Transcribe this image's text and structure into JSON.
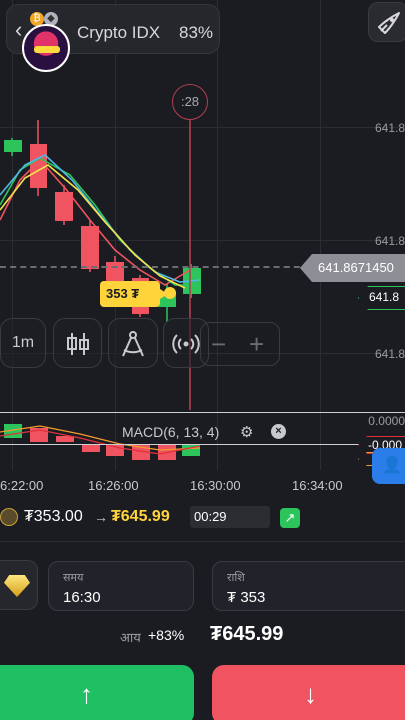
{
  "header": {
    "asset_name": "Crypto IDX",
    "payout_pct": "83%",
    "back_icon": "chevron-left-icon",
    "rocket_icon": "rocket-icon"
  },
  "chart": {
    "timer": ":28",
    "price_levels": [
      "641.8",
      "641.8",
      "641.8"
    ],
    "current_price": "641.8671450",
    "green_tag_price": "641.8",
    "trade_marker": "353 ₮",
    "tools": [
      "1m"
    ],
    "colors": {
      "up": "#2ec45c",
      "down": "#ef5460",
      "accent": "#ffd43b"
    }
  },
  "macd": {
    "label": "MACD(6, 13, 4)",
    "zero_label": "0.0000",
    "red_tag": "-0.000"
  },
  "time_axis": [
    "6:22:00",
    "16:26:00",
    "16:30:00",
    "16:34:00"
  ],
  "trade": {
    "from": "₮353.00",
    "arrow": "→",
    "to": "₮645.99",
    "time_left": "00:29"
  },
  "form": {
    "time_label": "समय",
    "time_value": "16:30",
    "amount_label": "राशि",
    "amount_value": "₮ 353"
  },
  "income": {
    "label": "आय",
    "pct": "+83%",
    "value": "₮645.99"
  },
  "actions": {
    "up_arrow": "↑",
    "down_arrow": "↓"
  }
}
